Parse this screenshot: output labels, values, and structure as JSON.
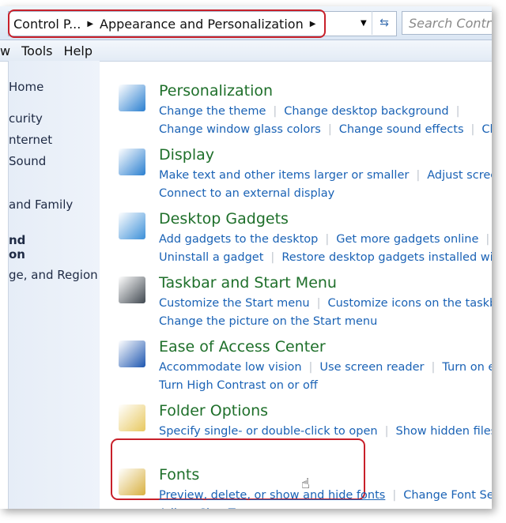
{
  "address": {
    "crumbs": [
      "Control P...",
      "Appearance and Personalization"
    ],
    "search_placeholder": "Search Contr"
  },
  "menu": [
    "w",
    "Tools",
    "Help"
  ],
  "sidebar": [
    "Home",
    "curity",
    "nternet",
    "Sound",
    "and Family",
    "nd",
    "on",
    "ge, and Region"
  ],
  "sections": [
    {
      "title": "Personalization",
      "icon": "personalization-icon",
      "color": "#2a7fd0",
      "lines": [
        [
          "Change the theme",
          "Change desktop background"
        ],
        [
          "Change window glass colors",
          "Change sound effects",
          "Change"
        ]
      ]
    },
    {
      "title": "Display",
      "icon": "display-icon",
      "color": "#2a7fd0",
      "lines": [
        [
          "Make text and other items larger or smaller",
          "Adjust screen reso"
        ],
        [
          "Connect to an external display"
        ]
      ]
    },
    {
      "title": "Desktop Gadgets",
      "icon": "gadgets-icon",
      "color": "#3b8fd8",
      "lines": [
        [
          "Add gadgets to the desktop",
          "Get more gadgets online"
        ],
        [
          "Uninstall a gadget",
          "Restore desktop gadgets installed with Win"
        ]
      ]
    },
    {
      "title": "Taskbar and Start Menu",
      "icon": "taskbar-icon",
      "color": "#404850",
      "lines": [
        [
          "Customize the Start menu",
          "Customize icons on the taskbar"
        ],
        [
          "Change the picture on the Start menu"
        ]
      ]
    },
    {
      "title": "Ease of Access Center",
      "icon": "ease-of-access-icon",
      "color": "#1d56b0",
      "lines": [
        [
          "Accommodate low vision",
          "Use screen reader",
          "Turn on easy a"
        ],
        [
          "Turn High Contrast on or off"
        ]
      ]
    },
    {
      "title": "Folder Options",
      "icon": "folder-icon",
      "color": "#e8c860",
      "lines": [
        [
          "Specify single- or double-click to open",
          "Show hidden files and"
        ]
      ]
    },
    {
      "title": "Fonts",
      "icon": "fonts-icon",
      "color": "#d8b040",
      "lines": [
        [
          "Preview, delete, or show and hide fonts",
          "Change Font Settings"
        ],
        [
          "Adjust ClearType text"
        ]
      ]
    }
  ]
}
